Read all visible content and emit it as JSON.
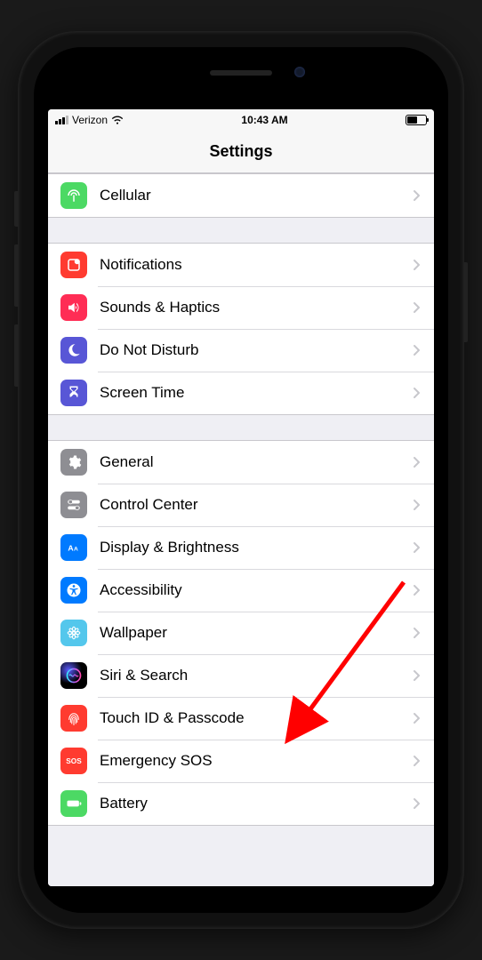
{
  "status_bar": {
    "carrier": "Verizon",
    "time": "10:43 AM",
    "battery_pct": 50
  },
  "header": {
    "title": "Settings"
  },
  "groups": [
    {
      "rows": [
        {
          "key": "cellular",
          "label": "Cellular",
          "icon": "antenna-icon",
          "color": "#4cd964"
        }
      ]
    },
    {
      "rows": [
        {
          "key": "notifications",
          "label": "Notifications",
          "icon": "notifications-icon",
          "color": "#ff3b30"
        },
        {
          "key": "sounds",
          "label": "Sounds & Haptics",
          "icon": "speaker-icon",
          "color": "#ff2d55"
        },
        {
          "key": "dnd",
          "label": "Do Not Disturb",
          "icon": "moon-icon",
          "color": "#5856d6"
        },
        {
          "key": "screentime",
          "label": "Screen Time",
          "icon": "hourglass-icon",
          "color": "#5856d6"
        }
      ]
    },
    {
      "rows": [
        {
          "key": "general",
          "label": "General",
          "icon": "gear-icon",
          "color": "#8e8e93"
        },
        {
          "key": "controlcenter",
          "label": "Control Center",
          "icon": "toggles-icon",
          "color": "#8e8e93"
        },
        {
          "key": "display",
          "label": "Display & Brightness",
          "icon": "textsize-icon",
          "color": "#007aff"
        },
        {
          "key": "accessibility",
          "label": "Accessibility",
          "icon": "accessibility-icon",
          "color": "#007aff"
        },
        {
          "key": "wallpaper",
          "label": "Wallpaper",
          "icon": "flower-icon",
          "color": "#54c7ec"
        },
        {
          "key": "siri",
          "label": "Siri & Search",
          "icon": "siri-icon",
          "color": "gradient-black"
        },
        {
          "key": "touchid",
          "label": "Touch ID & Passcode",
          "icon": "fingerprint-icon",
          "color": "#ff3b30"
        },
        {
          "key": "sos",
          "label": "Emergency SOS",
          "icon": "sos-icon",
          "color": "#ff3b30"
        },
        {
          "key": "battery",
          "label": "Battery",
          "icon": "battery-icon",
          "color": "#4cd964"
        }
      ]
    }
  ],
  "annotation": {
    "target_key": "touchid"
  }
}
